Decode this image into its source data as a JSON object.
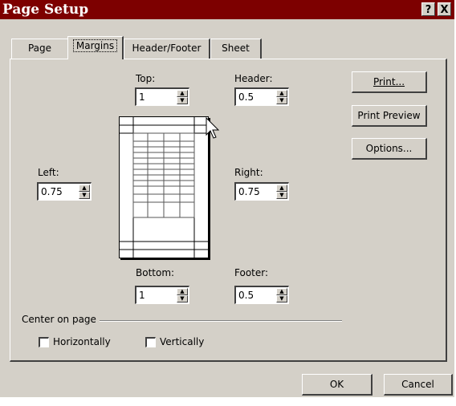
{
  "window": {
    "title": "Page Setup",
    "help_glyph": "?",
    "close_glyph": "X"
  },
  "tabs": [
    {
      "label": "Page",
      "active": false
    },
    {
      "label": "Margins",
      "active": true
    },
    {
      "label": "Header/Footer",
      "active": false
    },
    {
      "label": "Sheet",
      "active": false
    }
  ],
  "margins": {
    "top": {
      "label": "Top:",
      "value": "1"
    },
    "header": {
      "label": "Header:",
      "value": "0.5"
    },
    "left": {
      "label": "Left:",
      "value": "0.75"
    },
    "right": {
      "label": "Right:",
      "value": "0.75"
    },
    "bottom": {
      "label": "Bottom:",
      "value": "1"
    },
    "footer": {
      "label": "Footer:",
      "value": "0.5"
    }
  },
  "buttons": {
    "print": "Print...",
    "print_preview": "Print Preview",
    "options": "Options...",
    "ok": "OK",
    "cancel": "Cancel"
  },
  "center_on_page": {
    "label": "Center on page",
    "horizontally": {
      "label": "Horizontally",
      "checked": false
    },
    "vertically": {
      "label": "Vertically",
      "checked": false
    }
  },
  "colors": {
    "titlebar": "#7d0000",
    "face": "#d4d0c8"
  },
  "icons": {
    "spin_up": "spin-up-arrow-icon",
    "spin_down": "spin-down-arrow-icon",
    "cursor": "mouse-pointer-icon"
  }
}
